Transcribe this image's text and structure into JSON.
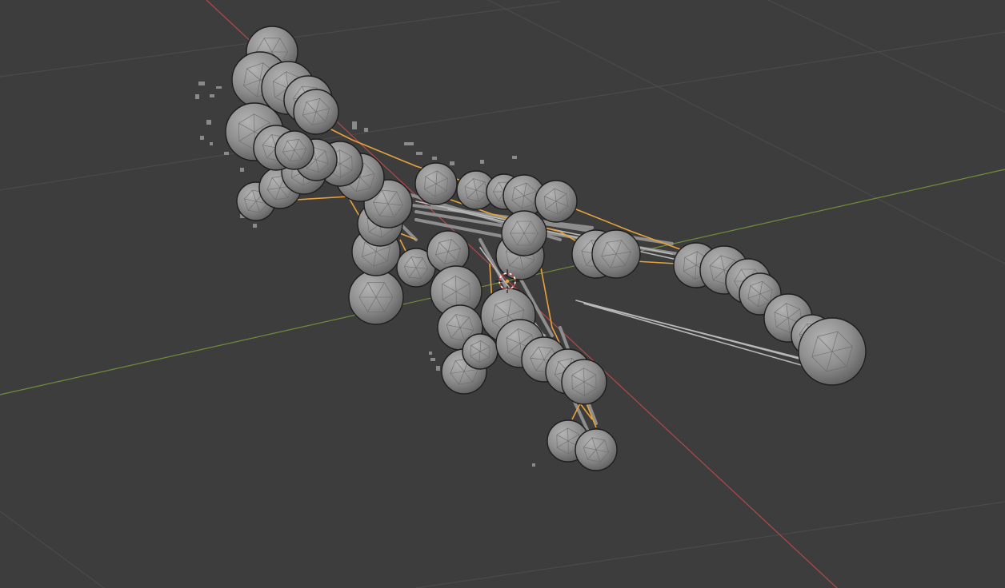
{
  "viewport": {
    "name": "3D Viewport",
    "background_color": "#3d3d3d",
    "grid_color": "#4a4a4a",
    "x_axis_color": "#b34a4a",
    "y_axis_color": "#6e8e3a",
    "selection_outline_color": "#e8a33a",
    "mesh_color": "#8e8e8e",
    "cursor_icon": "3d-cursor-icon"
  }
}
